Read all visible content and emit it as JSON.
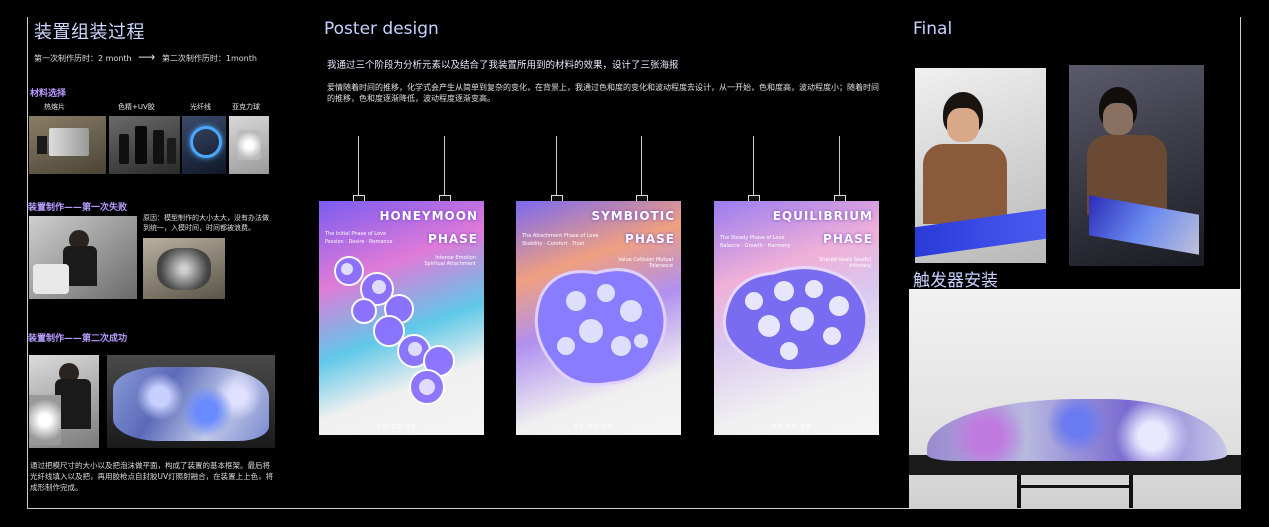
{
  "left": {
    "title": "装置组装过程",
    "timeline": {
      "first": "第一次制作历时：2 month",
      "arrow": "⟶",
      "second": "第二次制作历时：1month"
    },
    "materials_title": "材料选择",
    "materials": [
      "热熔片",
      "色精+UV胶",
      "光纤线",
      "亚克力球"
    ],
    "build1_title": "装置制作——第一次失败",
    "build1_note": "原因：模型制作的大小太大，没有办法做到统一，入模时间，时间都被浪费。",
    "build2_title": "装置制作——第二次成功",
    "build2_note": "通过把模尺寸的大小以及把泡沫做平面，构成了装置的基本框架。最后将光纤线填入以及把，再用胶枪点自封胶UV灯照射融合，在装置上上色，将成形制作完成。"
  },
  "middle": {
    "title": "Poster design",
    "intro": "我通过三个阶段为分析元素以及结合了我装置所用到的材料的效果，设计了三张海报",
    "desc": "爱情随着时间的推移，化学式会产生从简单到复杂的变化，在背景上，我通过色和度的变化和波动程度去设计，从一开始，色和度高，波动程度小；随着时间的推移，色和度逐渐降低，波动程度逐渐变高。",
    "posters": [
      {
        "title1": "HONEYMOON",
        "title2": "PHASE",
        "sub": "The Initial Phase of Love",
        "tags": "Passion · Desire · Romance",
        "right": "Intense Emotion Spiritual Attachment",
        "bottom": "00:00:00",
        "bg1": "#8a5cf0",
        "bg2": "#e88ad8"
      },
      {
        "title1": "SYMBIOTIC",
        "title2": "PHASE",
        "sub": "The Attachment Phase of Love",
        "tags": "Stability · Comfort · Trust",
        "right": "Value Collision Mutual Tolerance",
        "bottom": "00:00:00",
        "bg1": "#7b68f0",
        "bg2": "#f08a6a"
      },
      {
        "title1": "EQUILIBRIUM",
        "title2": "PHASE",
        "sub": "The Steady Phase of Love",
        "tags": "Balance · Growth · Harmony",
        "right": "Shared Goals Soulful Intimacy",
        "bottom": "00:00:00",
        "bg1": "#9a7cf0",
        "bg2": "#f0b0e0"
      }
    ]
  },
  "right": {
    "title": "Final",
    "trigger_title": "触发器安装"
  },
  "colors": {
    "heading": "#cfd6ff",
    "accent": "#b89cff",
    "background": "#000000"
  }
}
